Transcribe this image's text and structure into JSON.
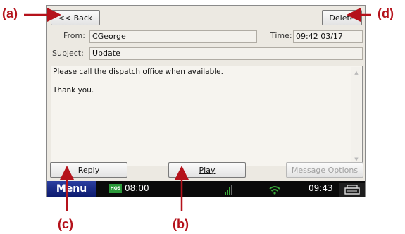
{
  "header": {
    "back_label": "<< Back",
    "delete_label": "Delete"
  },
  "fields": {
    "from_label": "From:",
    "from_value": "CGeorge",
    "time_label": "Time:",
    "time_value": "09:42  03/17",
    "subject_label": "Subject:",
    "subject_value": "Update"
  },
  "message": {
    "body": "Please call the dispatch office when available.\n\nThank you."
  },
  "actions": {
    "reply_label": "Reply",
    "play_label": "Play",
    "options_label": "Message Options"
  },
  "taskbar": {
    "menu_label": "Menu",
    "hos_badge": "HOS",
    "hos_time": "08:00",
    "clock": "09:43"
  },
  "annotations": {
    "a": "(a)",
    "b": "(b)",
    "c": "(c)",
    "d": "(d)"
  },
  "colors": {
    "annotation": "#b5121b",
    "menu": "#1a2a8a",
    "hos": "#2b9a3a",
    "signal": "#3aa83a"
  },
  "icons": [
    "back-arrow",
    "signal-bars-icon",
    "wifi-icon",
    "printer-icon",
    "scroll-up-icon",
    "scroll-down-icon"
  ]
}
